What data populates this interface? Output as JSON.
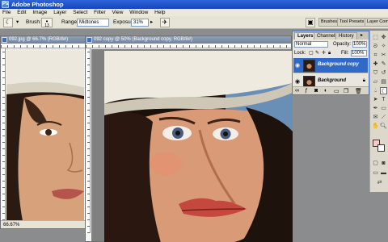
{
  "window": {
    "title": "Adobe Photoshop",
    "app_icon": "Ps"
  },
  "menu": [
    "File",
    "Edit",
    "Image",
    "Layer",
    "Select",
    "Filter",
    "View",
    "Window",
    "Help"
  ],
  "options": {
    "brush_label": "Brush:",
    "brush_size": "13",
    "range_label": "Range:",
    "range_value": "Midtones",
    "exposure_label": "Exposure:",
    "exposure_value": "31%"
  },
  "palette_well": [
    "Brushes",
    "Tool Presets",
    "Layer Comps"
  ],
  "documents": {
    "back": {
      "title": "092.jpg @ 66.7% (RGB/8#)",
      "status": "66.67%"
    },
    "front": {
      "title": "092 copy @ 50% (Background copy, RGB/8#)",
      "status": "50%"
    }
  },
  "layers_panel": {
    "tabs": [
      "Layers",
      "Channels",
      "History"
    ],
    "blend_mode": "Normal",
    "opacity_label": "Opacity:",
    "opacity_value": "100%",
    "lock_label": "Lock:",
    "fill_label": "Fill:",
    "fill_value": "100%",
    "layers": [
      {
        "name": "Background copy",
        "selected": true
      },
      {
        "name": "Background",
        "selected": false
      }
    ]
  },
  "colors": {
    "titlebar": "#2a5fd6",
    "selection": "#3169c6",
    "foreground": "#f7c9c9",
    "background": "#ffffff"
  }
}
